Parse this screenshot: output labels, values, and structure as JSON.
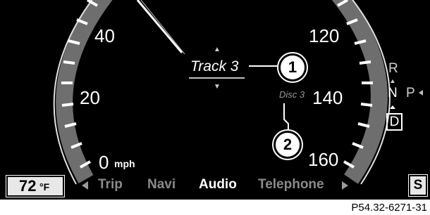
{
  "speedometer": {
    "unit": "mph",
    "left_labels": [
      "40",
      "20",
      "0"
    ],
    "right_labels": [
      "120",
      "140",
      "160"
    ]
  },
  "audio": {
    "track": "Track 3",
    "disc": "Disc 3"
  },
  "callouts": [
    "1",
    "2"
  ],
  "gear_indicator": {
    "r": "R",
    "n": "N",
    "p": "P",
    "d": "D"
  },
  "bottom_bar": {
    "temperature_value": "72",
    "temperature_unit": "°F",
    "menu_items": [
      "Trip",
      "Navi",
      "Audio",
      "Telephone"
    ],
    "active_menu": "Audio",
    "s_label": "S"
  },
  "figure_id": "P54.32-6271-31",
  "colors": {
    "background": "#000000",
    "text": "#ffffff",
    "inactive_menu": "#8a8a8a",
    "disc_text": "#9a9a9a",
    "gauge_band": "#7a7a7a"
  }
}
